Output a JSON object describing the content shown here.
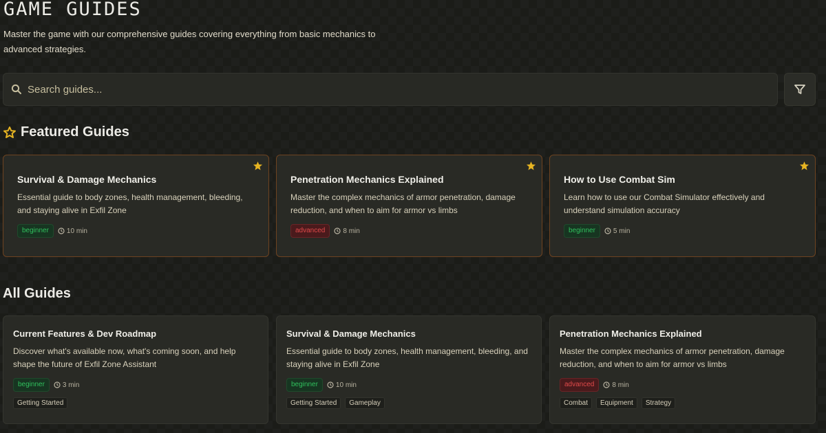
{
  "header": {
    "title": "GAME GUIDES",
    "subtitle": "Master the game with our comprehensive guides covering everything from basic mechanics to advanced strategies."
  },
  "search": {
    "placeholder": "Search guides...",
    "icon": "search-icon",
    "filter_icon": "filter-icon"
  },
  "featured": {
    "title": "Featured Guides",
    "icon": "star-outline-icon",
    "cards": [
      {
        "title": "Survival & Damage Mechanics",
        "description": "Essential guide to body zones, health management, bleeding, and staying alive in Exfil Zone",
        "level": "beginner",
        "time": "10 min"
      },
      {
        "title": "Penetration Mechanics Explained",
        "description": "Master the complex mechanics of armor penetration, damage reduction, and when to aim for armor vs limbs",
        "level": "advanced",
        "time": "8 min"
      },
      {
        "title": "How to Use Combat Sim",
        "description": "Learn how to use our Combat Simulator effectively and understand simulation accuracy",
        "level": "beginner",
        "time": "5 min"
      }
    ]
  },
  "all": {
    "title": "All Guides",
    "cards": [
      {
        "title": "Current Features & Dev Roadmap",
        "description": "Discover what's available now, what's coming soon, and help shape the future of Exfil Zone Assistant",
        "level": "beginner",
        "time": "3 min",
        "tags": [
          "Getting Started"
        ]
      },
      {
        "title": "Survival & Damage Mechanics",
        "description": "Essential guide to body zones, health management, bleeding, and staying alive in Exfil Zone",
        "level": "beginner",
        "time": "10 min",
        "tags": [
          "Getting Started",
          "Gameplay"
        ]
      },
      {
        "title": "Penetration Mechanics Explained",
        "description": "Master the complex mechanics of armor penetration, damage reduction, and when to aim for armor vs limbs",
        "level": "advanced",
        "time": "8 min",
        "tags": [
          "Combat",
          "Equipment",
          "Strategy"
        ]
      }
    ]
  },
  "colors": {
    "background": "#1b1c18",
    "card": "#292a25",
    "featured_border": "#6e4320",
    "accent_gold": "#e6b422",
    "beginner": "#30c05d",
    "advanced": "#e04a4a"
  }
}
